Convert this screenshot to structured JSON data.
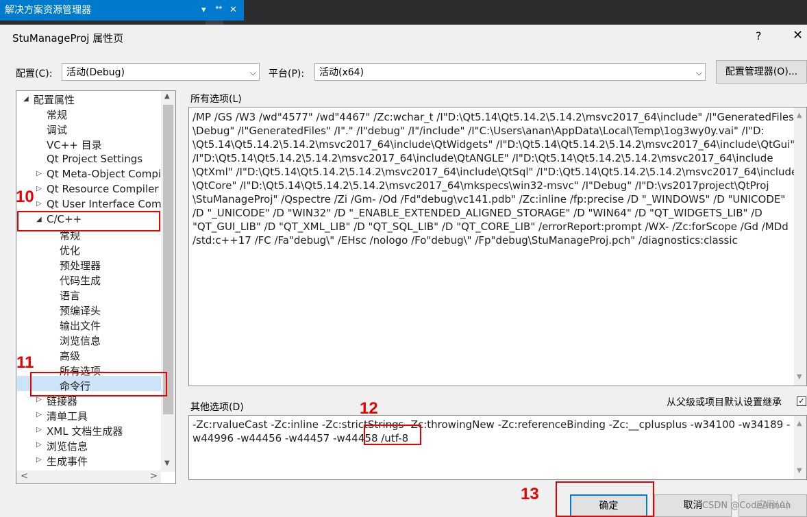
{
  "vs_panel": {
    "title": "解决方案资源管理器",
    "controls": [
      "▾",
      "ᕯ",
      "✕"
    ]
  },
  "dialog": {
    "title": "StuManageProj 属性页",
    "help_glyph": "?",
    "close_glyph": "✕"
  },
  "config": {
    "label": "配置(C):",
    "value": "活动(Debug)",
    "platform_label": "平台(P):",
    "platform_value": "活动(x64)",
    "manager_button": "配置管理器(O)..."
  },
  "tree": {
    "items": [
      {
        "label": "配置属性",
        "expander": "◢"
      },
      {
        "label": "常规",
        "expander": ""
      },
      {
        "label": "调试",
        "expander": ""
      },
      {
        "label": "VC++ 目录",
        "expander": ""
      },
      {
        "label": "Qt Project Settings",
        "expander": ""
      },
      {
        "label": "Qt Meta-Object Compi",
        "expander": "▷"
      },
      {
        "label": "Qt Resource Compiler",
        "expander": "▷"
      },
      {
        "label": "Qt User Interface Comp",
        "expander": "▷"
      },
      {
        "label": "C/C++",
        "expander": "◢"
      },
      {
        "label": "常规",
        "expander": ""
      },
      {
        "label": "优化",
        "expander": ""
      },
      {
        "label": "预处理器",
        "expander": ""
      },
      {
        "label": "代码生成",
        "expander": ""
      },
      {
        "label": "语言",
        "expander": ""
      },
      {
        "label": "预编译头",
        "expander": ""
      },
      {
        "label": "输出文件",
        "expander": ""
      },
      {
        "label": "浏览信息",
        "expander": ""
      },
      {
        "label": "高级",
        "expander": ""
      },
      {
        "label": "所有选项",
        "expander": ""
      },
      {
        "label": "命令行",
        "expander": ""
      },
      {
        "label": "链接器",
        "expander": "▷"
      },
      {
        "label": "清单工具",
        "expander": "▷"
      },
      {
        "label": "XML 文档生成器",
        "expander": "▷"
      },
      {
        "label": "浏览信息",
        "expander": "▷"
      },
      {
        "label": "生成事件",
        "expander": "▷"
      }
    ],
    "scroll_up": "▲",
    "scroll_down": "▼",
    "scroll_left": "<",
    "scroll_right": ">"
  },
  "all_options": {
    "label": "所有选项(L)",
    "lines": [
      "/MP /GS /W3 /wd\"4577\" /wd\"4467\" /Zc:wchar_t /I\"D:\\Qt5.14\\Qt5.14.2\\5.14.2\\msvc2017_64\\include\" /I\"GeneratedFiles",
      "\\Debug\" /I\"GeneratedFiles\" /I\".\" /I\"debug\" /I\"/include\" /I\"C:\\Users\\anan\\AppData\\Local\\Temp\\1og3wy0y.vai\" /I\"D:",
      "\\Qt5.14\\Qt5.14.2\\5.14.2\\msvc2017_64\\include\\QtWidgets\" /I\"D:\\Qt5.14\\Qt5.14.2\\5.14.2\\msvc2017_64\\include\\QtGui\"",
      "/I\"D:\\Qt5.14\\Qt5.14.2\\5.14.2\\msvc2017_64\\include\\QtANGLE\" /I\"D:\\Qt5.14\\Qt5.14.2\\5.14.2\\msvc2017_64\\include",
      "\\QtXml\" /I\"D:\\Qt5.14\\Qt5.14.2\\5.14.2\\msvc2017_64\\include\\QtSql\" /I\"D:\\Qt5.14\\Qt5.14.2\\5.14.2\\msvc2017_64\\include",
      "\\QtCore\" /I\"D:\\Qt5.14\\Qt5.14.2\\5.14.2\\msvc2017_64\\mkspecs\\win32-msvc\" /I\"Debug\" /I\"D:\\vs2017project\\QtProj",
      "\\StuManageProj\" /Qspectre /Zi /Gm- /Od /Fd\"debug\\vc141.pdb\" /Zc:inline /fp:precise /D \"_WINDOWS\" /D \"UNICODE\"",
      "/D \"_UNICODE\" /D \"WIN32\" /D \"_ENABLE_EXTENDED_ALIGNED_STORAGE\" /D \"WIN64\" /D \"QT_WIDGETS_LIB\" /D",
      "\"QT_GUI_LIB\" /D \"QT_XML_LIB\" /D \"QT_SQL_LIB\" /D \"QT_CORE_LIB\" /errorReport:prompt /WX- /Zc:forScope /Gd /MDd",
      "/std:c++17 /FC /Fa\"debug\\\" /EHsc /nologo /Fo\"debug\\\" /Fp\"debug\\StuManageProj.pch\" /diagnostics:classic"
    ]
  },
  "other_options": {
    "label": "其他选项(D)",
    "inherit_label": "从父级或项目默认设置继承",
    "inherit_checked": true,
    "check_glyph": "✓",
    "lines": [
      "-Zc:rvalueCast -Zc:inline -Zc:strictStrings -Zc:throwingNew -Zc:referenceBinding -Zc:__cplusplus -w34100 -w34189 -",
      "w44996 -w44456 -w44457 -w44458 /utf-8"
    ]
  },
  "buttons": {
    "ok": "确定",
    "cancel": "取消",
    "apply": "应用(A)"
  },
  "annotations": {
    "n10": "10",
    "n11": "11",
    "n12": "12",
    "n13": "13"
  },
  "watermark": "CSDN @CodeAnnun",
  "colors": {
    "accent": "#007acc",
    "annotation": "#e60000",
    "selection": "#cce4f7"
  }
}
